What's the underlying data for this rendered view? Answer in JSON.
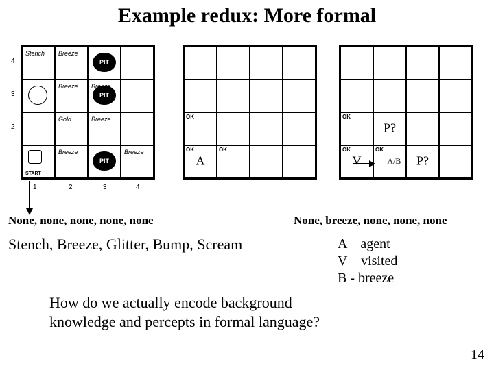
{
  "title": "Example redux: More formal",
  "left_grid": {
    "row_labels": [
      "4",
      "3",
      "2",
      ""
    ],
    "col_labels": [
      "1",
      "2",
      "3",
      "4"
    ],
    "pit_label": "PIT",
    "pits_rc": [
      [
        0,
        2
      ],
      [
        1,
        2
      ],
      [
        3,
        2
      ]
    ],
    "text_cells": {
      "0_0": "Stench",
      "0_1": "Breeze",
      "1_1": "Breeze",
      "1_2": "Breeze",
      "2_2": "Breeze",
      "3_1": "Breeze",
      "3_3": "Breeze",
      "2_1": "Gold"
    },
    "start_label": "START"
  },
  "mid_grid": {
    "cells": {
      "2_0": {
        "tl": "OK"
      },
      "3_0": {
        "tl": "OK",
        "center": "A"
      },
      "3_1": {
        "tl": "OK"
      }
    }
  },
  "right_grid": {
    "cells": {
      "2_0": {
        "tl": "OK"
      },
      "2_1": {
        "center": "P?"
      },
      "3_0": {
        "tl": "OK",
        "center": "V"
      },
      "3_1": {
        "tl": "OK",
        "ab": "A/B"
      },
      "3_2": {
        "center": "P?"
      }
    }
  },
  "percepts_left": "None, none, none, none, none",
  "percepts_right": "None, breeze, none, none, none",
  "sensors": "Stench, Breeze, Glitter, Bump, Scream",
  "legend": {
    "a": "A – agent",
    "v": "V – visited",
    "b": "B -  breeze"
  },
  "question_l1": "How do we actually encode background",
  "question_l2": "knowledge and percepts in formal language?",
  "pagenum": "14"
}
